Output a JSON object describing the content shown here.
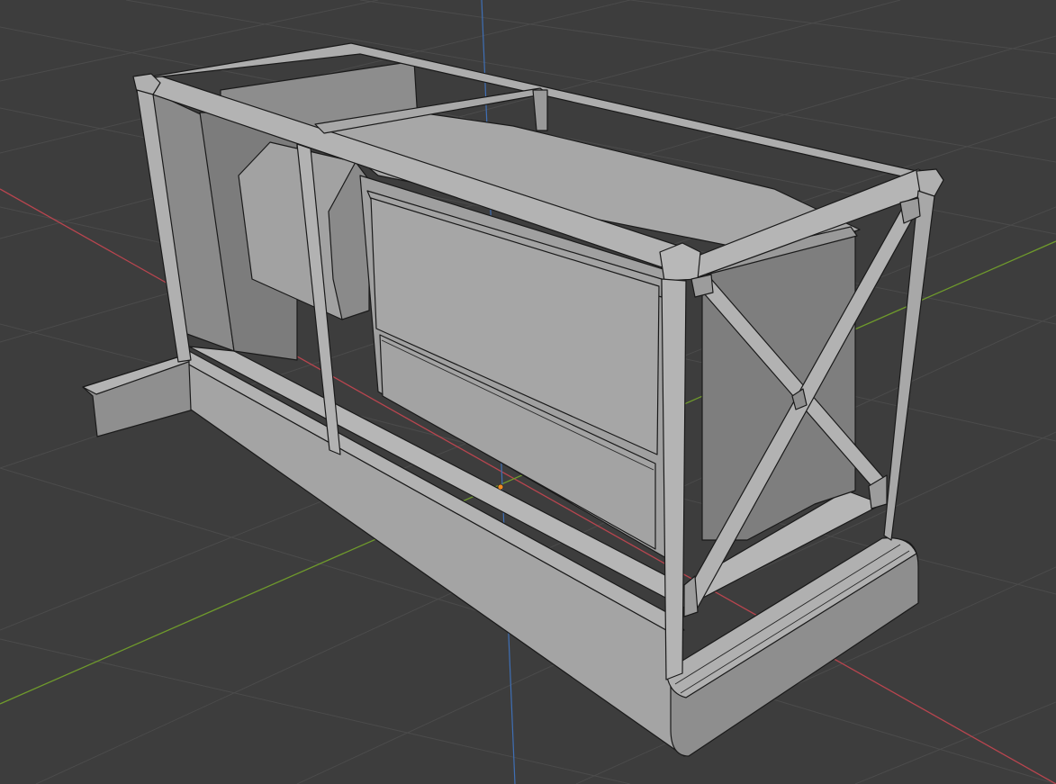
{
  "viewport": {
    "background": "#3d3d3d",
    "grid_line_color": "#4b4b4b",
    "x_axis_color": "#b8454f",
    "y_axis_color": "#6f9a2c",
    "z_axis_color": "#3f6fb5",
    "origin_color": "#f28a1e"
  },
  "object": {
    "description_icon": "mesh-object",
    "frame_color": "#a9a9a9",
    "panel_color": "#9a9a9a",
    "shadow_color": "#6a6a6a"
  }
}
